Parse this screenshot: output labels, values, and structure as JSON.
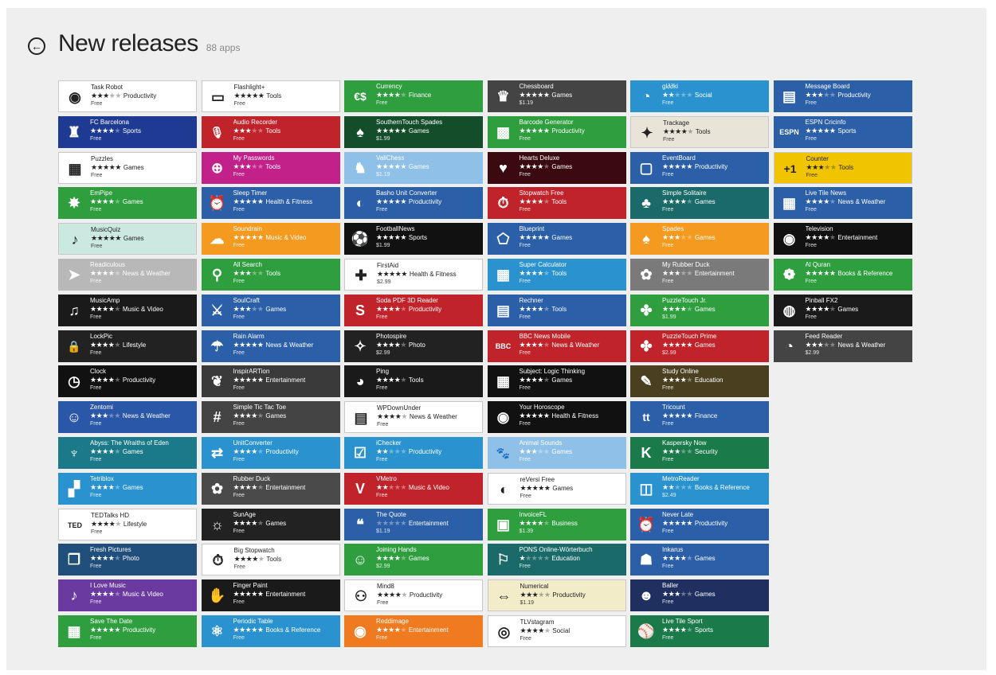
{
  "header": {
    "title": "New releases",
    "count": "88 apps",
    "back_icon": "back-arrow-icon"
  },
  "columns": [
    [
      {
        "name": "Task Robot",
        "stars": 3,
        "category": "Productivity",
        "price": "Free",
        "color": "#ffffff",
        "icon": "robot-icon",
        "glyph": "◉"
      },
      {
        "name": "FC Barcelona",
        "stars": 4,
        "category": "Sports",
        "price": "Free",
        "color": "#1f3a93",
        "icon": "crest-icon",
        "glyph": "♜"
      },
      {
        "name": "Puzzles",
        "stars": 5,
        "category": "Games",
        "price": "Free",
        "color": "#ffffff",
        "icon": "puzzle-icon",
        "glyph": "▦"
      },
      {
        "name": "EmPipe",
        "stars": 4,
        "category": "Games",
        "price": "Free",
        "color": "#2e9e3e",
        "icon": "pipe-icon",
        "glyph": "✸"
      },
      {
        "name": "MusicQuiz",
        "stars": 5,
        "category": "Games",
        "price": "Free",
        "color": "#cce9e1",
        "icon": "music-note-icon",
        "glyph": "♪"
      },
      {
        "name": "Readiculous",
        "stars": 4,
        "category": "News & Weather",
        "price": "Free",
        "color": "#b8b8b8",
        "icon": "reader-icon",
        "glyph": "➤"
      },
      {
        "name": "MusicAmp",
        "stars": 4,
        "category": "Music & Video",
        "price": "Free",
        "color": "#1a1a1a",
        "icon": "amp-icon",
        "glyph": "♫"
      },
      {
        "name": "LockPic",
        "stars": 4,
        "category": "Lifestyle",
        "price": "Free",
        "color": "#222222",
        "icon": "lock-pic-icon",
        "glyph": "🔒"
      },
      {
        "name": "Clock",
        "stars": 4,
        "category": "Productivity",
        "price": "Free",
        "color": "#111111",
        "icon": "clock-icon",
        "glyph": "◷"
      },
      {
        "name": "Zentomi",
        "stars": 3,
        "category": "News & Weather",
        "price": "Free",
        "color": "#2b57a8",
        "icon": "head-icon",
        "glyph": "☺"
      },
      {
        "name": "Abyss: The Wraiths of Eden",
        "stars": 4,
        "category": "Games",
        "price": "Free",
        "color": "#1a7a8a",
        "icon": "abyss-icon",
        "glyph": "♆"
      },
      {
        "name": "Tetriblox",
        "stars": 4,
        "category": "Games",
        "price": "Free",
        "color": "#2a92cf",
        "icon": "blocks-icon",
        "glyph": "▞"
      },
      {
        "name": "TEDTalks HD",
        "stars": 4,
        "category": "Lifestyle",
        "price": "Free",
        "color": "#ffffff",
        "icon": "ted-icon",
        "glyph": "TED"
      },
      {
        "name": "Fresh Pictures",
        "stars": 4,
        "category": "Photo",
        "price": "Free",
        "color": "#1f4f7a",
        "icon": "pictures-icon",
        "glyph": "❐"
      },
      {
        "name": "I Love Music",
        "stars": 4,
        "category": "Music & Video",
        "price": "Free",
        "color": "#6a3aa0",
        "icon": "music-icon",
        "glyph": "♪"
      },
      {
        "name": "Save The Date",
        "stars": 5,
        "category": "Productivity",
        "price": "Free",
        "color": "#2e9e3e",
        "icon": "calendar-icon",
        "glyph": "▦"
      }
    ],
    [
      {
        "name": "Flashlight+",
        "stars": 5,
        "category": "Tools",
        "price": "Free",
        "color": "#ffffff",
        "icon": "flashlight-icon",
        "glyph": "▭"
      },
      {
        "name": "Audio Recorder",
        "stars": 3,
        "category": "Tools",
        "price": "Free",
        "color": "#c0232a",
        "icon": "microphone-icon",
        "glyph": "🎙"
      },
      {
        "name": "My Passwords",
        "stars": 3,
        "category": "Tools",
        "price": "Free",
        "color": "#c2218a",
        "icon": "padlock-icon",
        "glyph": "⊕"
      },
      {
        "name": "Sleep Timer",
        "stars": 5,
        "category": "Health & Fitness",
        "price": "Free",
        "color": "#2b5fa8",
        "icon": "timer-icon",
        "glyph": "⏰"
      },
      {
        "name": "Soundrain",
        "stars": 5,
        "category": "Music & Video",
        "price": "Free",
        "color": "#f39a1f",
        "icon": "cloud-icon",
        "glyph": "☁"
      },
      {
        "name": "All Search",
        "stars": 3,
        "category": "Tools",
        "price": "Free",
        "color": "#2e9e3e",
        "icon": "search-icon",
        "glyph": "⚲"
      },
      {
        "name": "SoulCraft",
        "stars": 3,
        "category": "Games",
        "price": "Free",
        "color": "#2b5fa8",
        "icon": "soulcraft-icon",
        "glyph": "⚔"
      },
      {
        "name": "Rain Alarm",
        "stars": 5,
        "category": "News & Weather",
        "price": "Free",
        "color": "#2b5fa8",
        "icon": "rain-cloud-icon",
        "glyph": "☂"
      },
      {
        "name": "InspirARTion",
        "stars": 5,
        "category": "Entertainment",
        "price": "Free",
        "color": "#3a3a3a",
        "icon": "butterfly-icon",
        "glyph": "❦"
      },
      {
        "name": "Simple Tic Tac Toe",
        "stars": 4,
        "category": "Games",
        "price": "Free",
        "color": "#444444",
        "icon": "tic-tac-toe-icon",
        "glyph": "#"
      },
      {
        "name": "UnitConverter",
        "stars": 4,
        "category": "Productivity",
        "price": "Free",
        "color": "#2a92cf",
        "icon": "convert-icon",
        "glyph": "⇄"
      },
      {
        "name": "Rubber Duck",
        "stars": 4,
        "category": "Entertainment",
        "price": "Free",
        "color": "#4a4a4a",
        "icon": "duck-icon",
        "glyph": "✿"
      },
      {
        "name": "SunAge",
        "stars": 4,
        "category": "Games",
        "price": "Free",
        "color": "#222222",
        "icon": "sunage-icon",
        "glyph": "☼"
      },
      {
        "name": "Big Stopwatch",
        "stars": 4,
        "category": "Tools",
        "price": "Free",
        "color": "#ffffff",
        "icon": "stopwatch-icon",
        "glyph": "⏱"
      },
      {
        "name": "Finger Paint",
        "stars": 5,
        "category": "Entertainment",
        "price": "Free",
        "color": "#1a1a1a",
        "icon": "paint-hands-icon",
        "glyph": "✋"
      },
      {
        "name": "Periodic Table",
        "stars": 5,
        "category": "Books & Reference",
        "price": "Free",
        "color": "#2a92cf",
        "icon": "atom-icon",
        "glyph": "⚛"
      }
    ],
    [
      {
        "name": "Currency",
        "stars": 4,
        "category": "Finance",
        "price": "Free",
        "color": "#2e9e3e",
        "icon": "currency-icon",
        "glyph": "€$"
      },
      {
        "name": "SouthernTouch Spades",
        "stars": 5,
        "category": "Games",
        "price": "$1.99",
        "color": "#144d2a",
        "icon": "spade-card-icon",
        "glyph": "♠"
      },
      {
        "name": "ValiChess",
        "stars": 5,
        "category": "Games",
        "price": "$1.19",
        "color": "#8fc1e8",
        "icon": "chess-knight-icon",
        "glyph": "♞"
      },
      {
        "name": "Basho Unit Converter",
        "stars": 5,
        "category": "Productivity",
        "price": "Free",
        "color": "#2b5fa8",
        "icon": "converter-icon",
        "glyph": "◐"
      },
      {
        "name": "FootballNews",
        "stars": 5,
        "category": "Sports",
        "price": "$1.99",
        "color": "#111111",
        "icon": "football-icon",
        "glyph": "⚽"
      },
      {
        "name": "FirstAid",
        "stars": 5,
        "category": "Health & Fitness",
        "price": "$2.99",
        "color": "#ffffff",
        "icon": "first-aid-icon",
        "glyph": "✚"
      },
      {
        "name": "Soda PDF 3D Reader",
        "stars": 4,
        "category": "Productivity",
        "price": "Free",
        "color": "#c0232a",
        "icon": "pdf-icon",
        "glyph": "S"
      },
      {
        "name": "Photospire",
        "stars": 4,
        "category": "Photo",
        "price": "$2.99",
        "color": "#222222",
        "icon": "photo-icon",
        "glyph": "✧"
      },
      {
        "name": "Ping",
        "stars": 4,
        "category": "Tools",
        "price": "Free",
        "color": "#1a1a1a",
        "icon": "ping-icon",
        "glyph": "◕"
      },
      {
        "name": "WPDownUnder",
        "stars": 4,
        "category": "News & Weather",
        "price": "Free",
        "color": "#ffffff",
        "icon": "news-icon",
        "glyph": "▤"
      },
      {
        "name": "iChecker",
        "stars": 2,
        "category": "Productivity",
        "price": "Free",
        "color": "#2a92cf",
        "icon": "checkbox-icon",
        "glyph": "☑"
      },
      {
        "name": "VMetro",
        "stars": 2,
        "category": "Music & Video",
        "price": "Free",
        "color": "#c0232a",
        "icon": "vmetro-icon",
        "glyph": "V"
      },
      {
        "name": "The Quote",
        "stars": 0,
        "category": "Entertainment",
        "price": "$1.19",
        "color": "#2b5fa8",
        "icon": "quote-icon",
        "glyph": "❝"
      },
      {
        "name": "Joining Hands",
        "stars": 4,
        "category": "Games",
        "price": "$2.99",
        "color": "#2e9e3e",
        "icon": "hands-icon",
        "glyph": "☺"
      },
      {
        "name": "Mind8",
        "stars": 4,
        "category": "Productivity",
        "price": "Free",
        "color": "#ffffff",
        "icon": "mind-icon",
        "glyph": "⚇"
      },
      {
        "name": "Reddimage",
        "stars": 4,
        "category": "Entertainment",
        "price": "Free",
        "color": "#f07a1f",
        "icon": "reddit-icon",
        "glyph": "◉"
      }
    ],
    [
      {
        "name": "Chessboard",
        "stars": 5,
        "category": "Games",
        "price": "$1.19",
        "color": "#444444",
        "icon": "chessboard-icon",
        "glyph": "♛"
      },
      {
        "name": "Barcode Generator",
        "stars": 5,
        "category": "Productivity",
        "price": "Free",
        "color": "#2e9e3e",
        "icon": "qr-code-icon",
        "glyph": "▩"
      },
      {
        "name": "Hearts Deluxe",
        "stars": 4,
        "category": "Games",
        "price": "Free",
        "color": "#3a0a10",
        "icon": "heart-icon",
        "glyph": "♥"
      },
      {
        "name": "Stopwatch Free",
        "stars": 4,
        "category": "Tools",
        "price": "Free",
        "color": "#c0232a",
        "icon": "stopwatch-icon",
        "glyph": "⏱"
      },
      {
        "name": "Blueprint",
        "stars": 5,
        "category": "Games",
        "price": "Free",
        "color": "#2b5fa8",
        "icon": "blueprint-icon",
        "glyph": "⬠"
      },
      {
        "name": "Super Calculator",
        "stars": 4,
        "category": "Tools",
        "price": "Free",
        "color": "#2a92cf",
        "icon": "calculator-icon",
        "glyph": "▦"
      },
      {
        "name": "Rechner",
        "stars": 4,
        "category": "Tools",
        "price": "Free",
        "color": "#2b5fa8",
        "icon": "calculator-icon",
        "glyph": "▤"
      },
      {
        "name": "BBC News Mobile",
        "stars": 4,
        "category": "News & Weather",
        "price": "Free",
        "color": "#c0232a",
        "icon": "bbc-icon",
        "glyph": "BBC"
      },
      {
        "name": "Subject: Logic Thinking",
        "stars": 4,
        "category": "Games",
        "price": "Free",
        "color": "#111111",
        "icon": "logic-grid-icon",
        "glyph": "▦"
      },
      {
        "name": "Your Horoscope",
        "stars": 5,
        "category": "Health & Fitness",
        "price": "Free",
        "color": "#111111",
        "icon": "eye-icon",
        "glyph": "◉"
      },
      {
        "name": "Animal Sounds",
        "stars": 3,
        "category": "Games",
        "price": "Free",
        "color": "#8fc1e8",
        "icon": "animals-icon",
        "glyph": "🐾"
      },
      {
        "name": "reVersi Free",
        "stars": 5,
        "category": "Games",
        "price": "Free",
        "color": "#ffffff",
        "icon": "reversi-icon",
        "glyph": "◐"
      },
      {
        "name": "InvoiceFL",
        "stars": 4,
        "category": "Business",
        "price": "$1.39",
        "color": "#2e9e3e",
        "icon": "invoice-icon",
        "glyph": "▣"
      },
      {
        "name": "PONS Online-Wörterbuch",
        "stars": 1,
        "category": "Education",
        "price": "Free",
        "color": "#1a6a6a",
        "icon": "dictionary-icon",
        "glyph": "⚐"
      },
      {
        "name": "Numerical",
        "stars": 3,
        "category": "Productivity",
        "price": "$1.19",
        "color": "#f2ecc8",
        "icon": "numerical-icon",
        "glyph": "⇔"
      },
      {
        "name": "TLVstagram",
        "stars": 4,
        "category": "Social",
        "price": "Free",
        "color": "#ffffff",
        "icon": "camera-icon",
        "glyph": "◎"
      }
    ],
    [
      {
        "name": "gl∂∂ki",
        "stars": 2,
        "category": "Social",
        "price": "Free",
        "color": "#2a92cf",
        "icon": "bubble-icon",
        "glyph": "◔"
      },
      {
        "name": "Trackage",
        "stars": 4,
        "category": "Tools",
        "price": "Free",
        "color": "#e8e4d8",
        "icon": "moose-icon",
        "glyph": "✦"
      },
      {
        "name": "EventBoard",
        "stars": 5,
        "category": "Productivity",
        "price": "Free",
        "color": "#2b5fa8",
        "icon": "board-icon",
        "glyph": "▢"
      },
      {
        "name": "Simple Solitaire",
        "stars": 4,
        "category": "Games",
        "price": "Free",
        "color": "#1a6a6a",
        "icon": "cards-icon",
        "glyph": "♣"
      },
      {
        "name": "Spades",
        "stars": 3,
        "category": "Games",
        "price": "Free",
        "color": "#f39a1f",
        "icon": "spade-icon",
        "glyph": "♠"
      },
      {
        "name": "My Rubber Duck",
        "stars": 3,
        "category": "Entertainment",
        "price": "Free",
        "color": "#7a7a7a",
        "icon": "duck-icon",
        "glyph": "✿"
      },
      {
        "name": "PuzzleTouch Jr.",
        "stars": 4,
        "category": "Games",
        "price": "$1.99",
        "color": "#2e9e3e",
        "icon": "puzzle-piece-icon",
        "glyph": "✤"
      },
      {
        "name": "PuzzleTouch Prime",
        "stars": 5,
        "category": "Games",
        "price": "$2.99",
        "color": "#c0232a",
        "icon": "puzzle-piece-icon",
        "glyph": "✤"
      },
      {
        "name": "Study Online",
        "stars": 4,
        "category": "Education",
        "price": "Free",
        "color": "#4a4020",
        "icon": "study-icon",
        "glyph": "✎"
      },
      {
        "name": "Tricount",
        "stars": 5,
        "category": "Finance",
        "price": "Free",
        "color": "#2b5fa8",
        "icon": "tricount-icon",
        "glyph": "tt"
      },
      {
        "name": "Kaspersky Now",
        "stars": 3,
        "category": "Security",
        "price": "Free",
        "color": "#1a7a4a",
        "icon": "kaspersky-icon",
        "glyph": "K"
      },
      {
        "name": "MetroReader",
        "stars": 2,
        "category": "Books & Reference",
        "price": "$2.49",
        "color": "#2a92cf",
        "icon": "book-icon",
        "glyph": "◫"
      },
      {
        "name": "Never Late",
        "stars": 5,
        "category": "Productivity",
        "price": "Free",
        "color": "#2b5fa8",
        "icon": "alarm-icon",
        "glyph": "⏰"
      },
      {
        "name": "Inkarus",
        "stars": 4,
        "category": "Games",
        "price": "Free",
        "color": "#2b5fa8",
        "icon": "inkarus-icon",
        "glyph": "☗"
      },
      {
        "name": "Baller",
        "stars": 3,
        "category": "Games",
        "price": "Free",
        "color": "#1f3060",
        "icon": "baller-icon",
        "glyph": "☻"
      },
      {
        "name": "Live Tile Sport",
        "stars": 4,
        "category": "Sports",
        "price": "Free",
        "color": "#1a7a4a",
        "icon": "sport-icon",
        "glyph": "⚾"
      }
    ],
    [
      {
        "name": "Message Board",
        "stars": 3,
        "category": "Productivity",
        "price": "Free",
        "color": "#2b5fa8",
        "icon": "message-board-icon",
        "glyph": "▤"
      },
      {
        "name": "ESPN Cricinfo",
        "stars": 5,
        "category": "Sports",
        "price": "Free",
        "color": "#2b5fa8",
        "icon": "espn-icon",
        "glyph": "ESPN"
      },
      {
        "name": "Counter",
        "stars": 3,
        "category": "Tools",
        "price": "Free",
        "color": "#f0c400",
        "icon": "plus-one-icon",
        "glyph": "+1"
      },
      {
        "name": "Live Tile News",
        "stars": 4,
        "category": "News & Weather",
        "price": "Free",
        "color": "#2b5fa8",
        "icon": "news-tile-icon",
        "glyph": "▦"
      },
      {
        "name": "Television",
        "stars": 4,
        "category": "Entertainment",
        "price": "Free",
        "color": "#111111",
        "icon": "tv-icon",
        "glyph": "◉"
      },
      {
        "name": "Al Quran",
        "stars": 5,
        "category": "Books & Reference",
        "price": "Free",
        "color": "#2e9e3e",
        "icon": "quran-icon",
        "glyph": "❁"
      },
      {
        "name": "Pinball FX2",
        "stars": 4,
        "category": "Games",
        "price": "Free",
        "color": "#1a1a1a",
        "icon": "pinball-icon",
        "glyph": "◍"
      },
      {
        "name": "Feed Reader",
        "stars": 3,
        "category": "News & Weather",
        "price": "$2.99",
        "color": "#444444",
        "icon": "rss-icon",
        "glyph": "◔"
      }
    ]
  ]
}
